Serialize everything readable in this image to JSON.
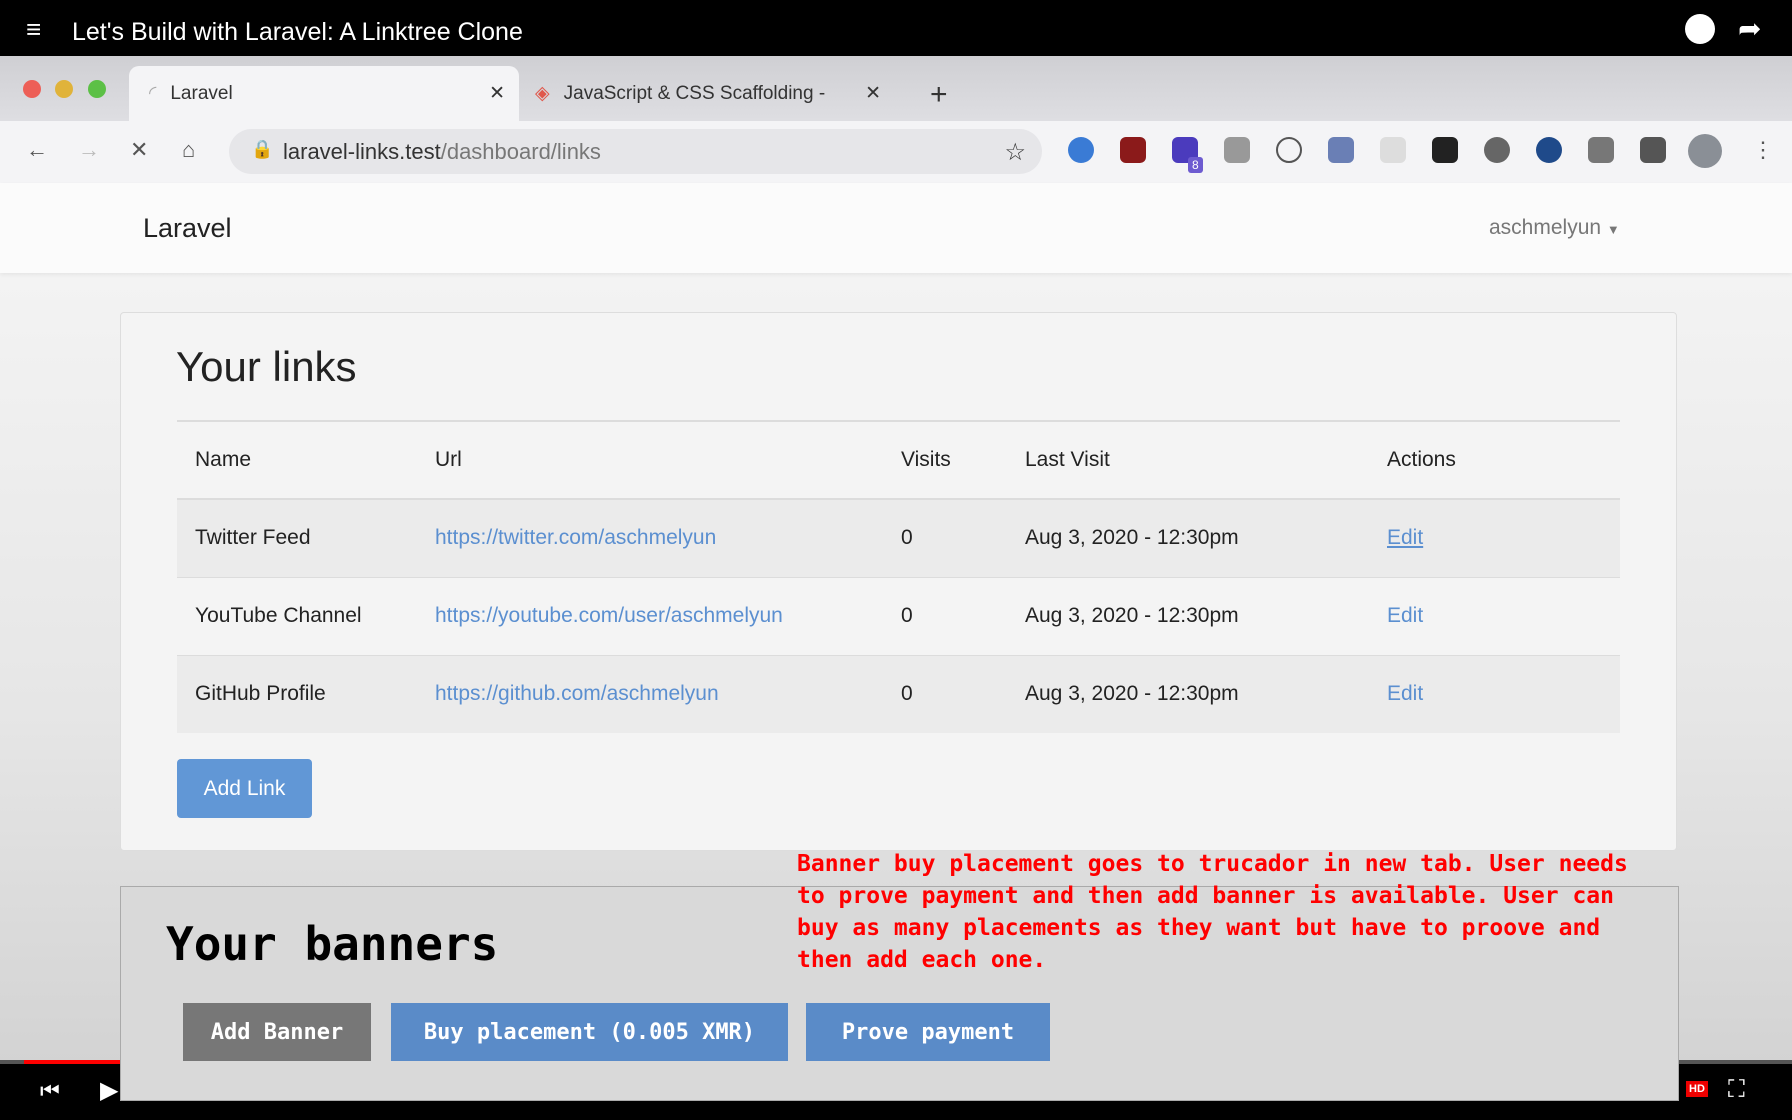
{
  "video": {
    "title": "Let's Build with Laravel: A Linktree Clone",
    "quality_badge": "HD"
  },
  "browser": {
    "tabs": [
      {
        "label": "Laravel",
        "active": true
      },
      {
        "label": "JavaScript & CSS Scaffolding -",
        "active": false
      }
    ],
    "url_host": "laravel-links.test",
    "url_path": "/dashboard/links",
    "extension_badge": "8"
  },
  "app": {
    "brand": "Laravel",
    "user": "aschmelyun"
  },
  "links": {
    "title": "Your links",
    "columns": [
      "Name",
      "Url",
      "Visits",
      "Last Visit",
      "Actions"
    ],
    "rows": [
      {
        "name": "Twitter Feed",
        "url": "https://twitter.com/aschmelyun",
        "visits": "0",
        "last_visit": "Aug 3, 2020 - 12:30pm",
        "action": "Edit"
      },
      {
        "name": "YouTube Channel",
        "url": "https://youtube.com/user/aschmelyun",
        "visits": "0",
        "last_visit": "Aug 3, 2020 - 12:30pm",
        "action": "Edit"
      },
      {
        "name": "GitHub Profile",
        "url": "https://github.com/aschmelyun",
        "visits": "0",
        "last_visit": "Aug 3, 2020 - 12:30pm",
        "action": "Edit"
      }
    ],
    "add_label": "Add Link"
  },
  "banners": {
    "title": "Your banners",
    "add_label": "Add Banner",
    "buy_label": "Buy placement (0.005 XMR)",
    "prove_label": "Prove payment",
    "note": "Banner buy placement goes to trucador in new tab. User needs to prove payment and then add banner is available. User can buy as many placements as they want but have to proove and then add each one."
  },
  "colors": {
    "accent": "#6197d6",
    "note": "#ff0000"
  }
}
